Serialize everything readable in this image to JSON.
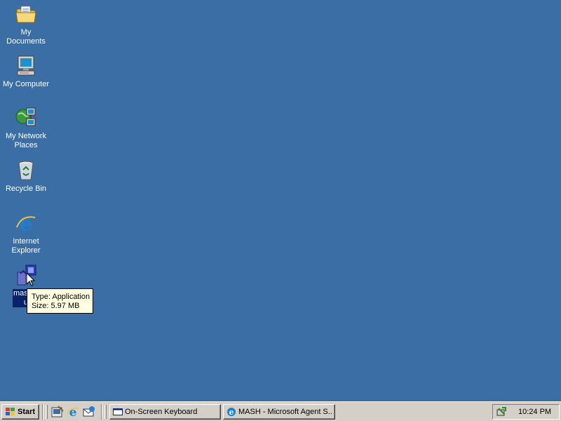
{
  "desktop": {
    "icons": [
      {
        "label": "My Documents",
        "icon": "folder-documents-icon"
      },
      {
        "label": "My Computer",
        "icon": "computer-icon"
      },
      {
        "label_line1": "My Network",
        "label_line2": "Places",
        "icon": "network-places-icon"
      },
      {
        "label": "Recycle Bin",
        "icon": "recycle-bin-icon"
      },
      {
        "label_line1": "Internet",
        "label_line2": "Explorer",
        "icon": "internet-explorer-icon"
      },
      {
        "label_line1": "mash_f",
        "label_line2": "u",
        "icon": "application-icon",
        "selected": true
      }
    ]
  },
  "tooltip": {
    "type": "Type: Application",
    "size": "Size: 5.97 MB"
  },
  "taskbar": {
    "start_label": "Start",
    "quick_launch": [
      "show-desktop-icon",
      "internet-explorer-icon",
      "outlook-express-icon"
    ],
    "tasks": [
      {
        "label": "On-Screen Keyboard",
        "icon": "keyboard-window-icon"
      },
      {
        "label": "MASH - Microsoft Agent S...",
        "icon": "mash-app-icon"
      }
    ],
    "tray": {
      "icon": "safely-remove-hardware-icon",
      "clock": "10:24 PM"
    }
  },
  "colors": {
    "desktop_bg": "#3a6ea5",
    "taskbar_bg": "#d4d0c8",
    "selection": "#0a246a",
    "tooltip_bg": "#ffffe1"
  }
}
